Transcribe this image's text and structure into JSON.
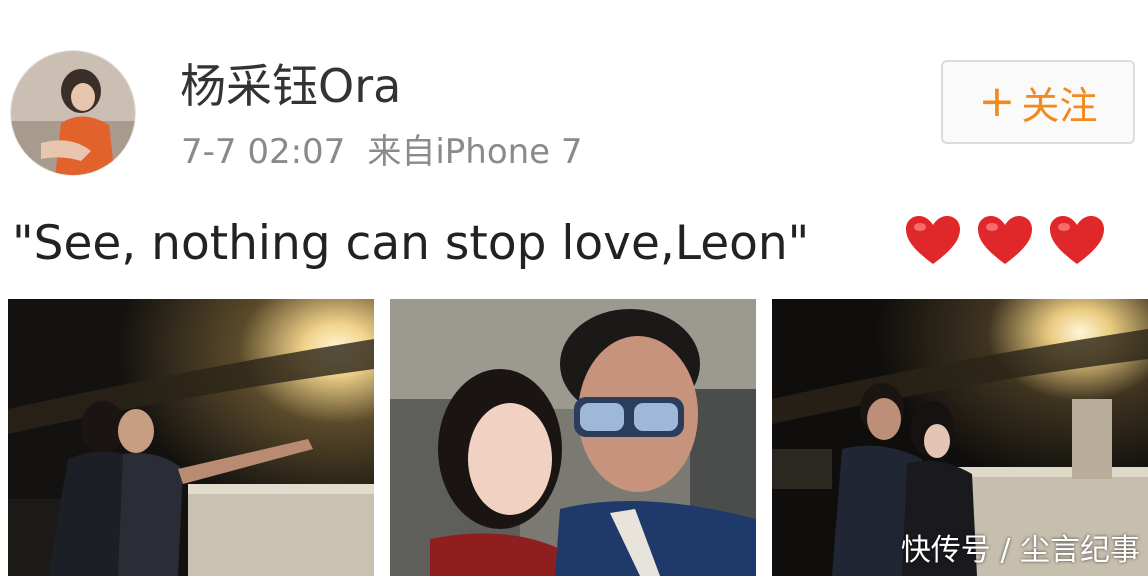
{
  "post": {
    "username": "杨采钰Ora",
    "time": "7-7 02:07",
    "source": "来自iPhone 7",
    "follow": {
      "icon": "plus-icon",
      "label": "关注"
    },
    "text": "\"See, nothing can stop love,Leon\"",
    "emojis": [
      "heart-emoji",
      "heart-emoji",
      "heart-emoji"
    ],
    "photos": [
      "night-selfie-photo",
      "couple-selfie-photo",
      "night-balcony-photo"
    ]
  },
  "watermark": "快传号 / 尘言纪事",
  "colors": {
    "follow_accent": "#f28a1e",
    "username": "#333333",
    "meta": "#8a8a8a",
    "heart": "#e0282b"
  }
}
